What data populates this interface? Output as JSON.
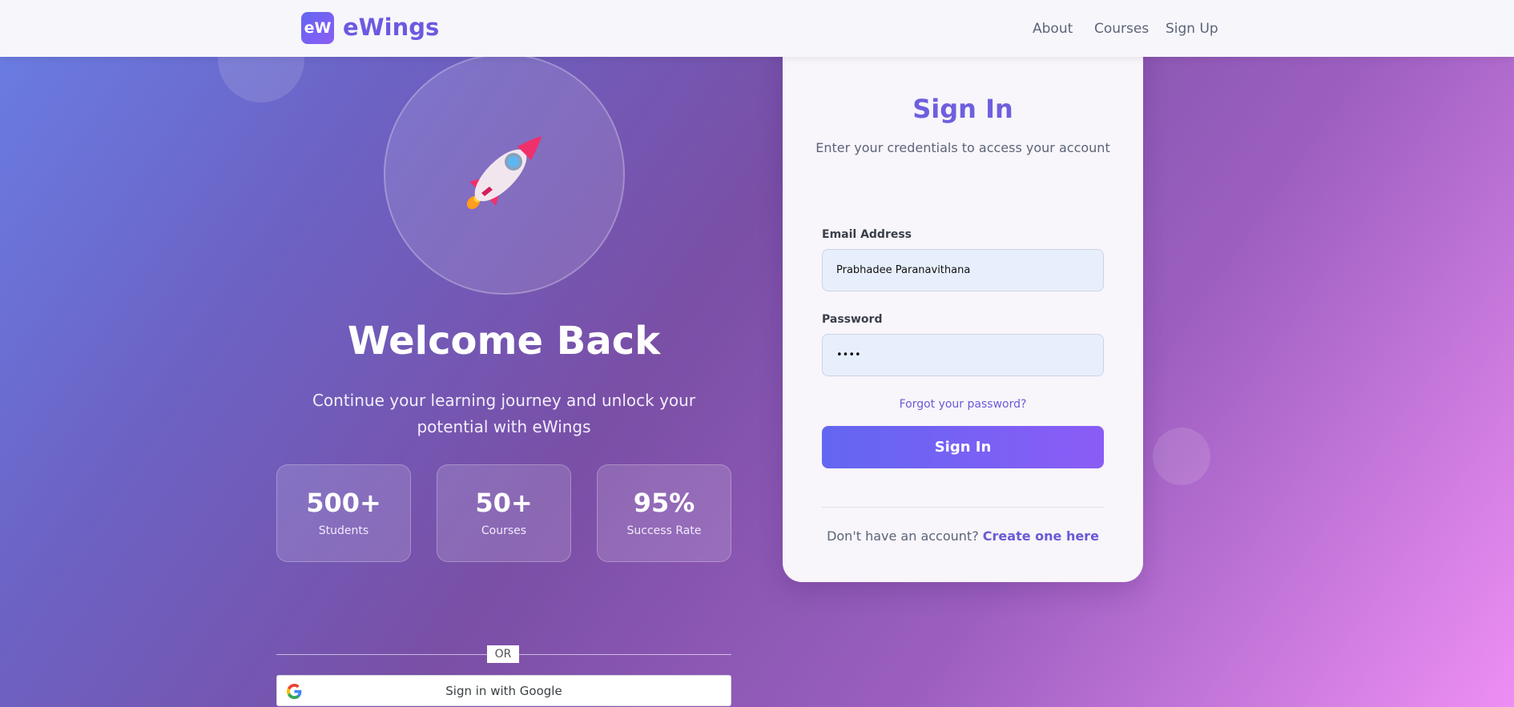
{
  "nav": {
    "logo_initials": "eW",
    "brand": "eWings",
    "links": [
      "About",
      "Courses",
      "Sign Up"
    ]
  },
  "hero": {
    "icon": "rocket-icon",
    "title": "Welcome Back",
    "subtitle": "Continue your learning journey and unlock your potential with eWings",
    "stats": [
      {
        "value": "500+",
        "label": "Students"
      },
      {
        "value": "50+",
        "label": "Courses"
      },
      {
        "value": "95%",
        "label": "Success Rate"
      }
    ],
    "divider_label": "OR",
    "google_label": "Sign in with Google"
  },
  "login": {
    "title": "Sign In",
    "subtitle": "Enter your credentials to access your account",
    "email_label": "Email Address",
    "email_value": "Prabhadee Paranavithana",
    "password_label": "Password",
    "password_value": "••••",
    "forgot_label": "Forgot your password?",
    "submit_label": "Sign In",
    "no_account_text": "Don't have an account?",
    "create_link": "Create one here"
  },
  "colors": {
    "accent": "#6366f1",
    "accent_2": "#8b5cf6",
    "brand_text": "#6b5ae0",
    "input_bg": "#e8effc"
  }
}
